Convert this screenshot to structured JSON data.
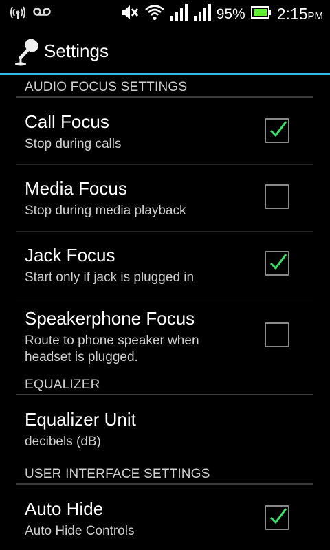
{
  "status": {
    "battery": "95%",
    "time": "2:15",
    "ampm": "PM",
    "icons": [
      "wifi-hotspot-icon",
      "voicemail-icon",
      "mute-icon",
      "wifi-icon",
      "signal-icon",
      "signal-icon",
      "battery-icon"
    ]
  },
  "actionbar": {
    "title": "Settings",
    "icon": "microphone-icon"
  },
  "sections": {
    "audio_focus": "AUDIO FOCUS SETTINGS",
    "equalizer": "EQUALIZER",
    "user_interface": "USER INTERFACE SETTINGS"
  },
  "items": {
    "call_focus": {
      "title": "Call Focus",
      "summary": "Stop during calls",
      "checked": true
    },
    "media_focus": {
      "title": "Media Focus",
      "summary": "Stop during media playback",
      "checked": false
    },
    "jack_focus": {
      "title": "Jack Focus",
      "summary": "Start only if jack is plugged in",
      "checked": true
    },
    "speakerphone_focus": {
      "title": "Speakerphone Focus",
      "summary": "Route to phone speaker when headset is plugged.",
      "checked": false
    },
    "equalizer_unit": {
      "title": "Equalizer Unit",
      "summary": "decibels (dB)"
    },
    "auto_hide": {
      "title": "Auto Hide",
      "summary": "Auto Hide Controls",
      "checked": true
    }
  },
  "colors": {
    "accent": "#33b5e5",
    "check": "#33e566"
  }
}
